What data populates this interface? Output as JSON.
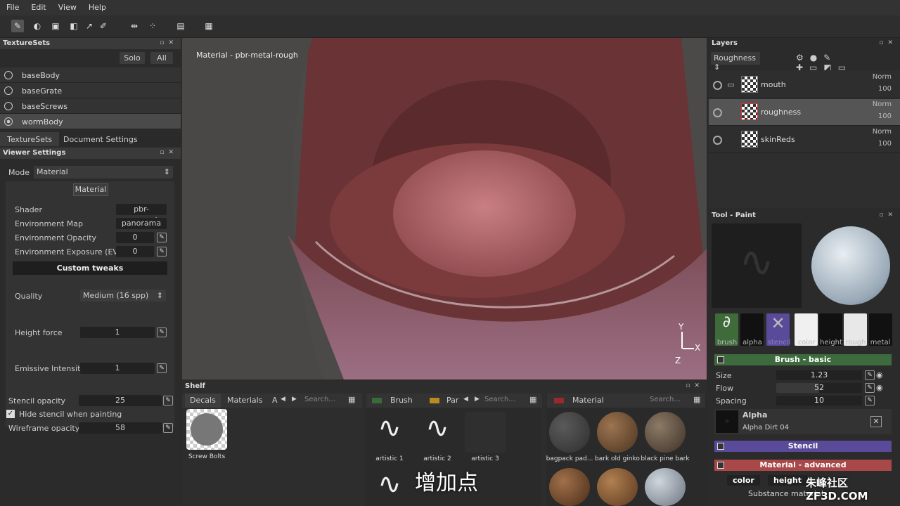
{
  "menu": [
    "File",
    "Edit",
    "View",
    "Help"
  ],
  "texturesets": {
    "title": "TextureSets",
    "solo": "Solo",
    "all": "All",
    "items": [
      "baseBody",
      "baseGrate",
      "baseScrews",
      "wormBody"
    ],
    "tabs": [
      "TextureSets",
      "Document Settings"
    ]
  },
  "viewer": {
    "title": "Viewer Settings",
    "mode_label": "Mode",
    "mode_value": "Material",
    "material_tab": "Material",
    "rows": [
      {
        "label": "Shader",
        "value": "pbr-m...rough"
      },
      {
        "label": "Environment Map",
        "value": "panorama"
      },
      {
        "label": "Environment Opacity",
        "value": "0"
      },
      {
        "label": "Environment Exposure (EV)",
        "value": "0"
      }
    ],
    "custom": "Custom tweaks",
    "quality_label": "Quality",
    "quality_value": "Medium (16 spp)",
    "height_label": "Height force",
    "height_value": "1",
    "emissive_label": "Emissive Intensity",
    "emissive_value": "1",
    "stencil_label": "Stencil opacity",
    "stencil_value": "25",
    "hide_stencil": "Hide stencil when painting",
    "wire_label": "Wireframe opacity",
    "wire_value": "58"
  },
  "viewport": {
    "label": "Material - pbr-metal-rough",
    "axis_y": "Y",
    "axis_x": "X",
    "axis_z": "Z"
  },
  "shelf": {
    "title": "Shelf",
    "tabs1": [
      "Decals",
      "Materials",
      "A"
    ],
    "search": "Search...",
    "item1": "Screw Bolts",
    "brush_tab": "Brush",
    "par_tab": "Par",
    "brushes": [
      "artistic 1",
      "artistic 2",
      "artistic 3"
    ],
    "material_tab": "Material",
    "materials": [
      "bagpack pad...",
      "bark old ginko",
      "black pine bark"
    ]
  },
  "layers": {
    "title": "Layers",
    "channel": "Roughness",
    "items": [
      {
        "name": "mouth",
        "blend": "Norm",
        "opacity": "100"
      },
      {
        "name": "roughness",
        "blend": "Norm",
        "opacity": "100"
      },
      {
        "name": "skinReds",
        "blend": "Norm",
        "opacity": "100"
      }
    ]
  },
  "tool": {
    "title": "Tool - Paint",
    "channels": [
      "brush",
      "alpha",
      "stencil",
      "color",
      "height",
      "rough",
      "metal"
    ],
    "brush_basic": "Brush - basic",
    "size_label": "Size",
    "size_value": "1.23",
    "flow_label": "Flow",
    "flow_value": "52",
    "spacing_label": "Spacing",
    "spacing_value": "10",
    "alpha_label": "Alpha",
    "alpha_name": "Alpha Dirt 04",
    "stencil": "Stencil",
    "mat_adv": "Material - advanced",
    "mat_btns": [
      "color",
      "height"
    ],
    "substance": "Substance material"
  },
  "subtitle": "增加点",
  "watermark": "朱峰社区 ZF3D.COM"
}
